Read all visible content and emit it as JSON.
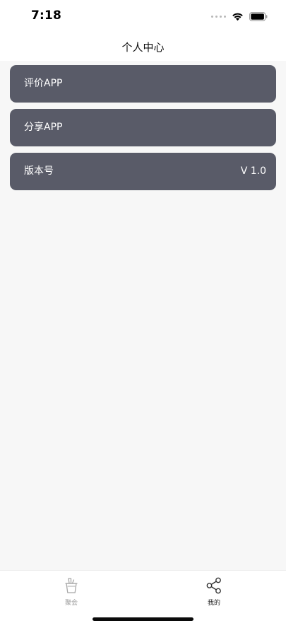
{
  "status_bar": {
    "time": "7:18",
    "wifi_icon": "wifi-icon",
    "battery_icon": "battery-icon"
  },
  "nav": {
    "title": "个人中心"
  },
  "menu": {
    "items": [
      {
        "label": "评价APP",
        "value": ""
      },
      {
        "label": "分享APP",
        "value": ""
      },
      {
        "label": "版本号",
        "value": "V 1.0"
      }
    ]
  },
  "tab_bar": {
    "tabs": [
      {
        "label": "聚会",
        "icon": "drink-bucket-icon",
        "active": false
      },
      {
        "label": "我的",
        "icon": "share-icon",
        "active": true
      }
    ]
  },
  "colors": {
    "row_background": "#595b68",
    "page_background": "#f7f7f7",
    "active_tab": "#222222",
    "inactive_tab": "#9a9a9a"
  }
}
